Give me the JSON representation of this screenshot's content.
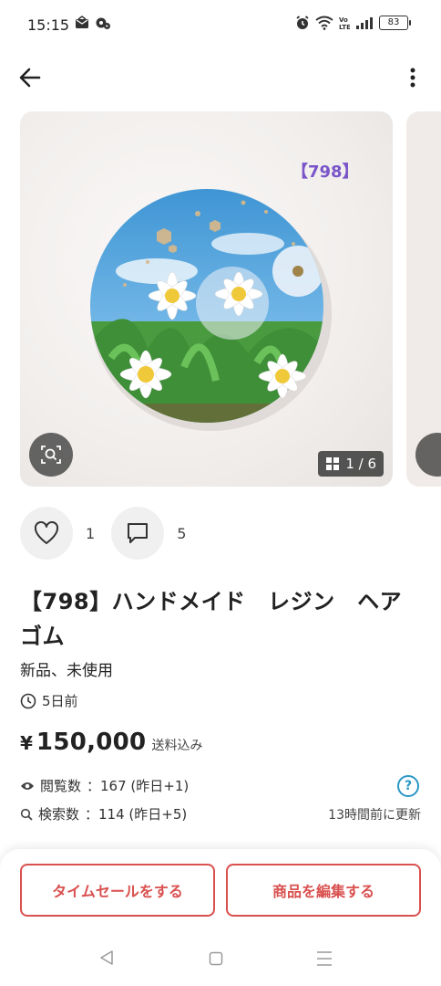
{
  "status_bar": {
    "time": "15:15",
    "battery": "83",
    "icons": [
      "mail-icon",
      "settings-icon",
      "alarm-icon",
      "wifi-icon",
      "volte-icon",
      "signal-icon",
      "battery-icon"
    ]
  },
  "gallery": {
    "photo_label": "【798】",
    "counter": "1 / 6"
  },
  "reactions": {
    "likes": "1",
    "comments": "5"
  },
  "item": {
    "title": "【798】ハンドメイド　レジン　ヘアゴム",
    "condition": "新品、未使用",
    "posted": "5日前",
    "price_symbol": "¥",
    "price": "150,000",
    "shipping": "送料込み"
  },
  "stats": {
    "views_label": "閲覧数",
    "views_value": "：167 (昨日+1)",
    "search_label": "検索数",
    "search_value": "：114 (昨日+5)",
    "updated": "13時間前に更新",
    "help": "?"
  },
  "actions": {
    "time_sale": "タイムセールをする",
    "edit": "商品を編集する"
  },
  "colors": {
    "accent": "#d9504f",
    "help_blue": "#2a97c6",
    "label_purple": "#7a55c9"
  }
}
